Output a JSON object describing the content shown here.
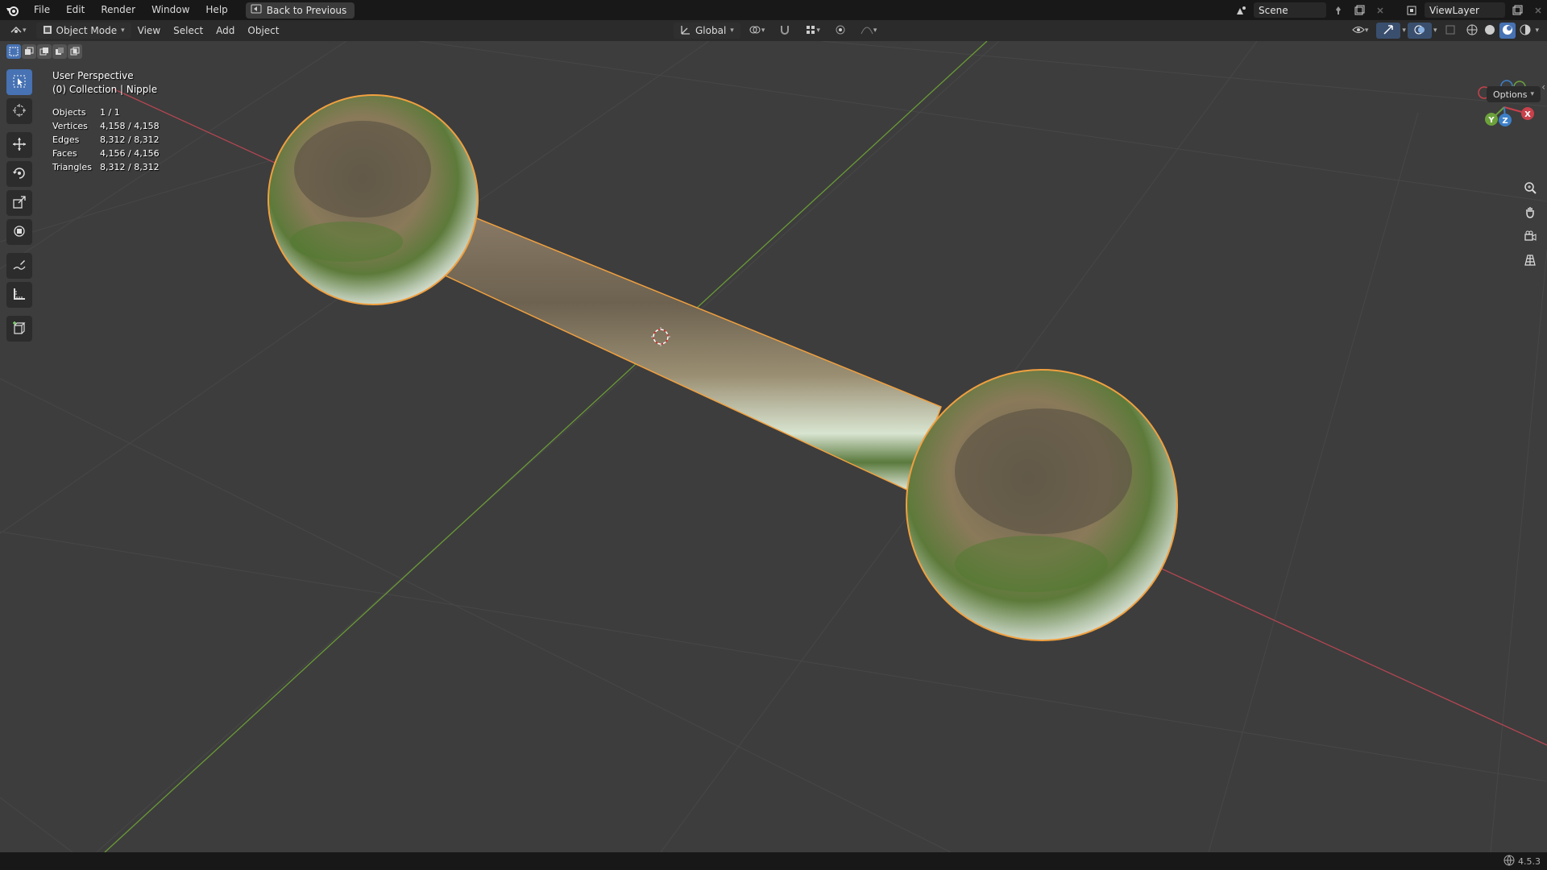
{
  "topbar": {
    "menus": [
      "File",
      "Edit",
      "Render",
      "Window",
      "Help"
    ],
    "back_button": "Back to Previous",
    "scene": "Scene",
    "view_layer": "ViewLayer"
  },
  "header": {
    "mode": "Object Mode",
    "menus": [
      "View",
      "Select",
      "Add",
      "Object"
    ],
    "orientation": "Global"
  },
  "viewport": {
    "perspective": "User Perspective",
    "collection": "(0) Collection | Nipple",
    "options_label": "Options",
    "stats": [
      {
        "label": "Objects",
        "value": "1 / 1"
      },
      {
        "label": "Vertices",
        "value": "4,158 / 4,158"
      },
      {
        "label": "Edges",
        "value": "8,312 / 8,312"
      },
      {
        "label": "Faces",
        "value": "4,156 / 4,156"
      },
      {
        "label": "Triangles",
        "value": "8,312 / 8,312"
      }
    ],
    "axes": {
      "x": "X",
      "y": "Y",
      "z": "Z"
    }
  },
  "toolbar": {
    "tools": [
      "select-box",
      "cursor",
      "move",
      "rotate",
      "scale",
      "transform",
      "annotate",
      "measure",
      "add-cube"
    ]
  },
  "statusbar": {
    "version": "4.5.3"
  },
  "colors": {
    "accent": "#4772b3",
    "x_axis": "#c8414b",
    "y_axis": "#6ca13b",
    "z_axis": "#3d80c8",
    "selection_outline": "#f0a040"
  }
}
